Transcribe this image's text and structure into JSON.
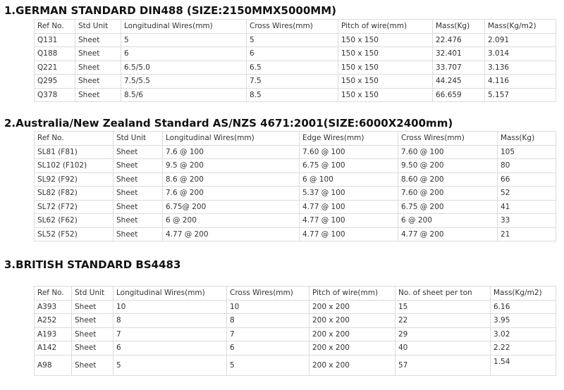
{
  "sections": [
    {
      "title": "1.GERMAN STANDARD DIN488 (SIZE:2150MMX5000MM)",
      "headers": [
        "Ref No.",
        "Std Unit",
        "Longitudinal Wires(mm)",
        "Cross Wires(mm)",
        "Pitch of wire(mm)",
        "Mass(Kg)",
        "Mass(Kg/m2)"
      ],
      "rows": [
        [
          "Q131",
          "Sheet",
          "5",
          "5",
          "150 x 150",
          "22.476",
          "2.091"
        ],
        [
          "Q188",
          "Sheet",
          "6",
          "6",
          "150 x 150",
          "32.401",
          "3.014"
        ],
        [
          "Q221",
          "Sheet",
          "6.5/5.0",
          "6.5",
          "150 x 150",
          "33.707",
          "3.136"
        ],
        [
          "Q295",
          "Sheet",
          "7.5/5.5",
          "7.5",
          "150 x 150",
          "44.245",
          "4.116"
        ],
        [
          "Q378",
          "Sheet",
          "8.5/6",
          "8.5",
          "150 x 150",
          "66.659",
          "5.157"
        ]
      ]
    },
    {
      "title": "2.Australia/New Zealand Standard AS/NZS 4671:2001(SIZE:6000X2400mm)",
      "headers": [
        "Ref No.",
        "Std Unit",
        "Longitudinal Wires(mm)",
        "Edge Wires(mm)",
        "Cross Wires(mm)",
        "Mass(Kg)"
      ],
      "rows": [
        [
          "SL81 (F81)",
          "Sheet",
          "7.6 @ 100",
          "7.60 @ 100",
          "7.60 @ 100",
          "105"
        ],
        [
          "SL102 (F102)",
          "Sheet",
          "9.5  @ 200",
          "6.75 @ 100",
          "9.50 @ 200",
          "80"
        ],
        [
          "SL92 (F92)",
          "Sheet",
          "8.6  @ 200",
          "6    @ 100",
          "8.60 @ 200",
          "66"
        ],
        [
          "SL82 (F82)",
          "Sheet",
          "7.6  @ 200",
          "5.37 @ 100",
          "7.60 @ 200",
          "52"
        ],
        [
          "SL72 (F72)",
          "Sheet",
          "6.75@ 200",
          "4.77 @ 100",
          "6.75 @ 200",
          "41"
        ],
        [
          "SL62 (F62)",
          "Sheet",
          " 6    @ 200",
          "4.77 @ 100",
          "6    @ 200",
          "33"
        ],
        [
          "SL52 (F52)",
          "Sheet",
          "4.77 @ 200",
          "4.77 @ 100",
          "4.77 @ 200",
          "21"
        ]
      ]
    },
    {
      "title": "3.BRITISH STANDARD BS4483",
      "headers": [
        "Ref No.",
        "Std Unit",
        "Longitudinal Wires(mm)",
        "Cross Wires(mm)",
        "Pitch of wire(mm)",
        "No. of sheet per ton",
        "Mass(Kg/m2)"
      ],
      "rows": [
        [
          "A393",
          "Sheet",
          "10",
          "10",
          "200 x 200",
          "15",
          "6.16"
        ],
        [
          "A252",
          "Sheet",
          "8",
          "8",
          "200 x 200",
          "22",
          "3.95"
        ],
        [
          "A193",
          "Sheet",
          "7",
          "7",
          "200 x 200",
          "29",
          "3.02"
        ],
        [
          "A142",
          "Sheet",
          "6",
          "6",
          "200 x 200",
          "40",
          "2.22"
        ],
        [
          "A98",
          "Sheet",
          "5",
          "5",
          "200 x 200",
          "57",
          "1.54"
        ]
      ]
    }
  ]
}
